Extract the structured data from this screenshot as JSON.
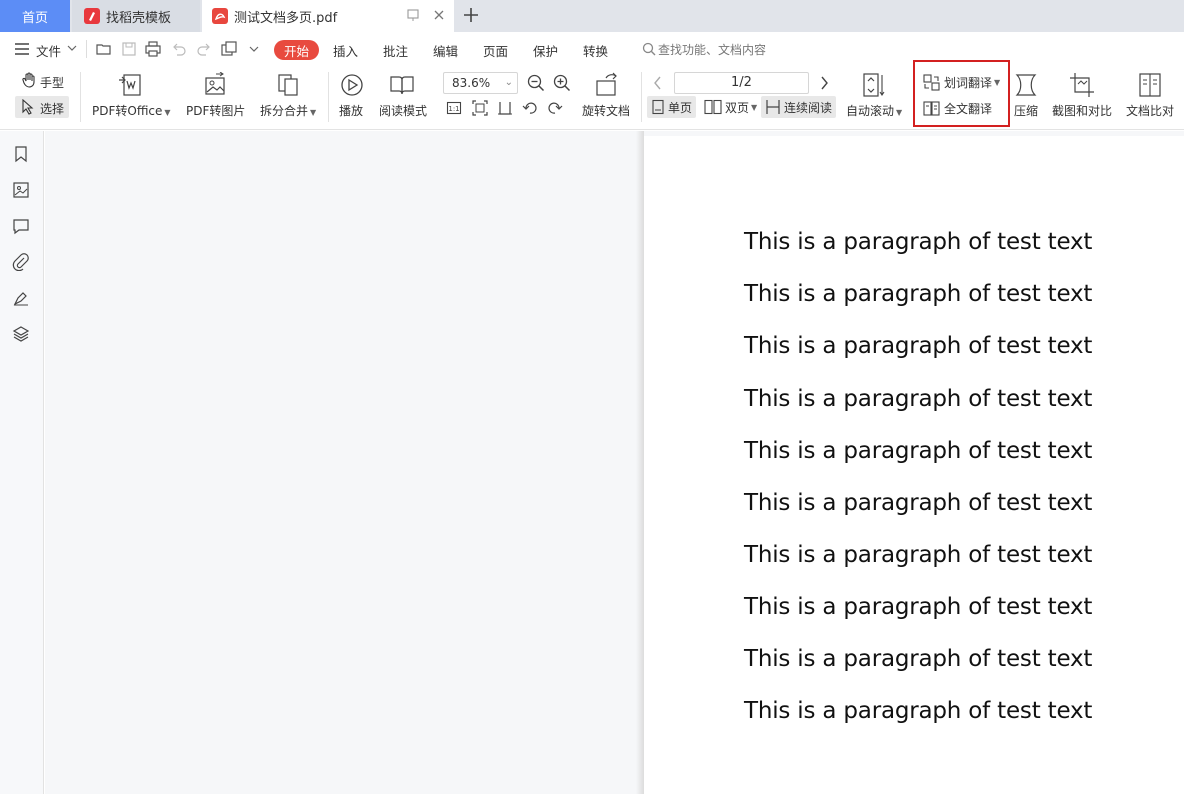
{
  "tabs": {
    "home": "首页",
    "template": "找稻壳模板",
    "document": "测试文档多页.pdf"
  },
  "menu": {
    "file": "文件",
    "start": "开始",
    "items": [
      "插入",
      "批注",
      "编辑",
      "页面",
      "保护",
      "转换"
    ],
    "search_placeholder": "查找功能、文档内容"
  },
  "ribbon": {
    "hand": "手型",
    "select": "选择",
    "pdf_to_office": "PDF转Office",
    "pdf_to_image": "PDF转图片",
    "split_merge": "拆分合并",
    "play": "播放",
    "read_mode": "阅读模式",
    "zoom": "83.6%",
    "rotate_doc": "旋转文档",
    "page_indicator": "1/2",
    "single_page": "单页",
    "double_page": "双页",
    "continuous": "连续阅读",
    "auto_scroll": "自动滚动",
    "word_translate": "划词翻译",
    "full_translate": "全文翻译",
    "compress": "压缩",
    "screenshot_compare": "截图和对比",
    "doc_compare": "文档比对"
  },
  "document": {
    "paragraphs": [
      "This is a paragraph of test text",
      "This is a paragraph of test text",
      "This is a paragraph of test text",
      "This is a paragraph of test text",
      "This is a paragraph of test text",
      "This is a paragraph of test text",
      "This is a paragraph of test text",
      "This is a paragraph of test text",
      "This is a paragraph of test text",
      "This is a paragraph of test text"
    ]
  },
  "colors": {
    "accent_blue": "#5c8df6",
    "start_red": "#e84a3f",
    "highlight_red": "#d32020"
  }
}
